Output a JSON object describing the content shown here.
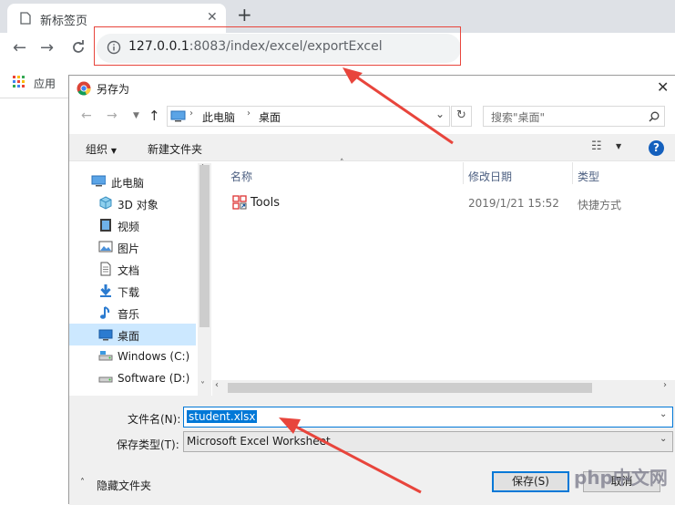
{
  "browser": {
    "tab_title": "新标签页",
    "url_host": "127.0.0.1",
    "url_rest": ":8083/index/excel/exportExcel",
    "bookmark_apps": "应用"
  },
  "dialog": {
    "title": "另存为",
    "breadcrumb": [
      "此电脑",
      "桌面"
    ],
    "search_placeholder": "搜索\"桌面\"",
    "organize": "组织",
    "new_folder": "新建文件夹",
    "nav_items": [
      {
        "label": "此电脑",
        "icon": "computer-icon"
      },
      {
        "label": "3D 对象",
        "icon": "cube-icon"
      },
      {
        "label": "视频",
        "icon": "video-icon"
      },
      {
        "label": "图片",
        "icon": "picture-icon"
      },
      {
        "label": "文档",
        "icon": "document-icon"
      },
      {
        "label": "下载",
        "icon": "download-icon"
      },
      {
        "label": "音乐",
        "icon": "music-icon"
      },
      {
        "label": "桌面",
        "icon": "desktop-icon"
      },
      {
        "label": "Windows (C:)",
        "icon": "drive-icon"
      },
      {
        "label": "Software (D:)",
        "icon": "drive-icon"
      }
    ],
    "columns": [
      "名称",
      "修改日期",
      "类型"
    ],
    "files": [
      {
        "name": "Tools",
        "date": "2019/1/21 15:52",
        "type": "快捷方式"
      }
    ],
    "filename_label": "文件名(N):",
    "filename_value": "student.xlsx",
    "filetype_label": "保存类型(T):",
    "filetype_value": "Microsoft Excel Worksheet",
    "hide_folders": "隐藏文件夹",
    "save": "保存(S)",
    "cancel": "取消"
  },
  "watermark": "php中文网",
  "colors": {
    "accent": "#0078d7",
    "annotation": "#e8453c",
    "selected_nav": "#cce8ff"
  }
}
